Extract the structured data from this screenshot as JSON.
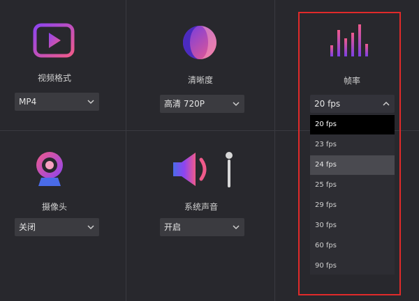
{
  "video_format": {
    "label": "视频格式",
    "value": "MP4",
    "icon": "play-icon"
  },
  "resolution": {
    "label": "清晰度",
    "value": "高清 720P",
    "icon": "resolution-circle-icon"
  },
  "frame_rate": {
    "label": "帧率",
    "value": "20 fps",
    "icon": "frame-rate-bars-icon",
    "options": [
      "20 fps",
      "23 fps",
      "24 fps",
      "25 fps",
      "29 fps",
      "30 fps",
      "60 fps",
      "90 fps"
    ],
    "selected_option": "20 fps",
    "hovered_option": "24 fps"
  },
  "camera": {
    "label": "摄像头",
    "value": "关闭",
    "icon": "webcam-icon"
  },
  "system_audio": {
    "label": "系统声音",
    "value": "开启",
    "icon": "speaker-icon"
  },
  "colors": {
    "highlight_border": "#e12a2a",
    "accent_pink": "#e84a7f",
    "accent_purple": "#7b3fe4"
  }
}
